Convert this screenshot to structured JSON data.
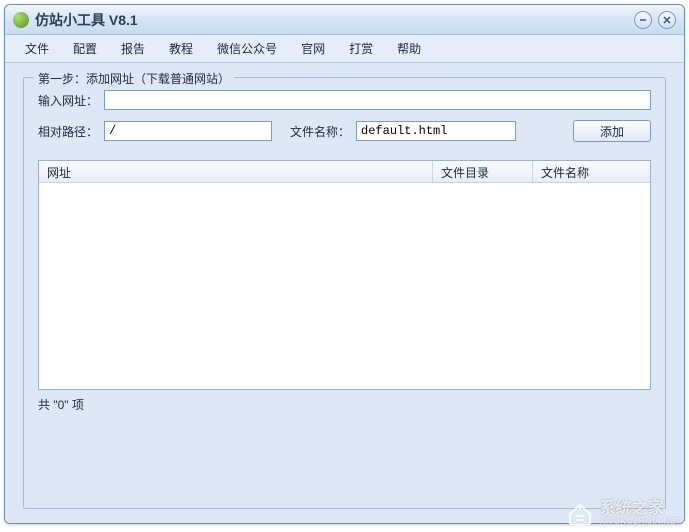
{
  "window": {
    "title": "仿站小工具 V8.1"
  },
  "menu": {
    "items": [
      "文件",
      "配置",
      "报告",
      "教程",
      "微信公众号",
      "官网",
      "打赏",
      "帮助"
    ]
  },
  "group": {
    "title": "第一步：添加网址（下载普通网站）",
    "url_label": "输入网址：",
    "url_value": "",
    "path_label": "相对路径：",
    "path_value": "/",
    "filename_label": "文件名称：",
    "filename_value": "default.html",
    "add_button": "添加"
  },
  "table": {
    "columns": [
      "网址",
      "文件目录",
      "文件名称"
    ],
    "rows": []
  },
  "status": {
    "text_prefix": "共 \"",
    "count": "0",
    "text_suffix": "\" 项"
  },
  "watermark": {
    "text": "系统之家",
    "sub": "XITONGZHIJIA.NET"
  }
}
